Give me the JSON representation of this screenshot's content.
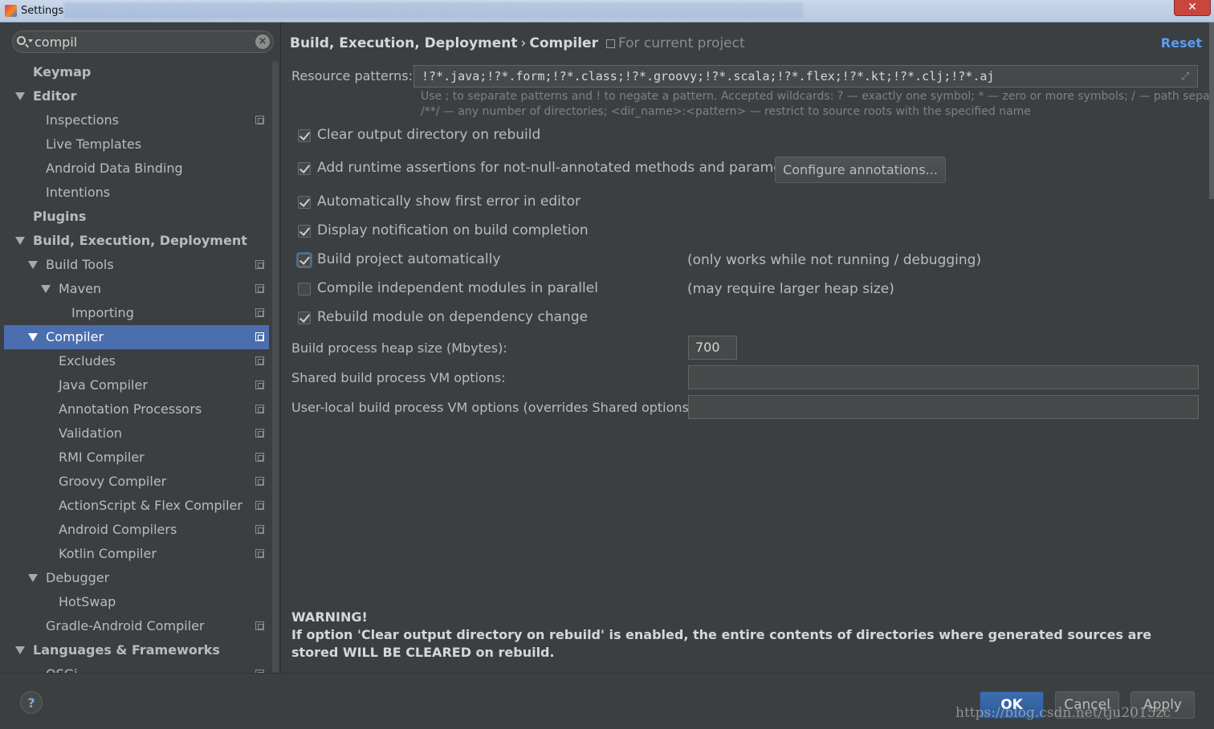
{
  "window": {
    "title": "Settings",
    "close_label": "✕"
  },
  "search": {
    "value": "compil"
  },
  "tree": [
    {
      "label": "Keymap",
      "bold": true,
      "indent": 0,
      "arrow": false,
      "proj": false
    },
    {
      "label": "Editor",
      "bold": true,
      "indent": 0,
      "arrow": true,
      "proj": false
    },
    {
      "label": "Inspections",
      "bold": false,
      "indent": 1,
      "arrow": false,
      "proj": true
    },
    {
      "label": "Live Templates",
      "bold": false,
      "indent": 1,
      "arrow": false,
      "proj": false
    },
    {
      "label": "Android Data Binding",
      "bold": false,
      "indent": 1,
      "arrow": false,
      "proj": false
    },
    {
      "label": "Intentions",
      "bold": false,
      "indent": 1,
      "arrow": false,
      "proj": false
    },
    {
      "label": "Plugins",
      "bold": true,
      "indent": 0,
      "arrow": false,
      "proj": false
    },
    {
      "label": "Build, Execution, Deployment",
      "bold": true,
      "indent": 0,
      "arrow": true,
      "proj": false
    },
    {
      "label": "Build Tools",
      "bold": false,
      "indent": 1,
      "arrow": true,
      "proj": true
    },
    {
      "label": "Maven",
      "bold": false,
      "indent": 2,
      "arrow": true,
      "proj": true
    },
    {
      "label": "Importing",
      "bold": false,
      "indent": 3,
      "arrow": false,
      "proj": true
    },
    {
      "label": "Compiler",
      "bold": false,
      "indent": 1,
      "arrow": true,
      "proj": true,
      "selected": true
    },
    {
      "label": "Excludes",
      "bold": false,
      "indent": 2,
      "arrow": false,
      "proj": true
    },
    {
      "label": "Java Compiler",
      "bold": false,
      "indent": 2,
      "arrow": false,
      "proj": true
    },
    {
      "label": "Annotation Processors",
      "bold": false,
      "indent": 2,
      "arrow": false,
      "proj": true
    },
    {
      "label": "Validation",
      "bold": false,
      "indent": 2,
      "arrow": false,
      "proj": true
    },
    {
      "label": "RMI Compiler",
      "bold": false,
      "indent": 2,
      "arrow": false,
      "proj": true
    },
    {
      "label": "Groovy Compiler",
      "bold": false,
      "indent": 2,
      "arrow": false,
      "proj": true
    },
    {
      "label": "ActionScript & Flex Compiler",
      "bold": false,
      "indent": 2,
      "arrow": false,
      "proj": true
    },
    {
      "label": "Android Compilers",
      "bold": false,
      "indent": 2,
      "arrow": false,
      "proj": true
    },
    {
      "label": "Kotlin Compiler",
      "bold": false,
      "indent": 2,
      "arrow": false,
      "proj": true
    },
    {
      "label": "Debugger",
      "bold": false,
      "indent": 1,
      "arrow": true,
      "proj": false
    },
    {
      "label": "HotSwap",
      "bold": false,
      "indent": 2,
      "arrow": false,
      "proj": false
    },
    {
      "label": "Gradle-Android Compiler",
      "bold": false,
      "indent": 1,
      "arrow": false,
      "proj": true
    },
    {
      "label": "Languages & Frameworks",
      "bold": true,
      "indent": 0,
      "arrow": true,
      "proj": false
    },
    {
      "label": "OSGi",
      "bold": false,
      "indent": 1,
      "arrow": false,
      "proj": true
    }
  ],
  "header": {
    "crumb1": "Build, Execution, Deployment",
    "sep": "›",
    "crumb2": "Compiler",
    "scope": "For current project",
    "reset": "Reset"
  },
  "resource": {
    "label": "Resource patterns:",
    "value": "!?*.java;!?*.form;!?*.class;!?*.groovy;!?*.scala;!?*.flex;!?*.kt;!?*.clj;!?*.aj",
    "hint1": "Use ; to separate patterns and ! to negate a pattern. Accepted wildcards: ? — exactly one symbol; * — zero or more symbols; / — path separator;",
    "hint2": "/**/ — any number of directories; <dir_name>:<pattern> — restrict to source roots with the specified name"
  },
  "options": {
    "clear_output": {
      "label": "Clear output directory on rebuild",
      "checked": true
    },
    "runtime_assertions": {
      "label": "Add runtime assertions for not-null-annotated methods and parameters",
      "checked": true
    },
    "configure_annotations": "Configure annotations...",
    "show_first_error": {
      "label": "Automatically show first error in editor",
      "checked": true
    },
    "notify_build": {
      "label": "Display notification on build completion",
      "checked": true
    },
    "build_auto": {
      "label": "Build project automatically",
      "checked": true,
      "note": "(only works while not running / debugging)"
    },
    "parallel": {
      "label": "Compile independent modules in parallel",
      "checked": false,
      "note": "(may require larger heap size)"
    },
    "rebuild_dep": {
      "label": "Rebuild module on dependency change",
      "checked": true
    }
  },
  "heap": {
    "label": "Build process heap size (Mbytes):",
    "value": "700"
  },
  "shared_vm": {
    "label": "Shared build process VM options:",
    "value": ""
  },
  "user_vm": {
    "label": "User-local build process VM options (overrides Shared options):",
    "value": ""
  },
  "warning": {
    "title": "WARNING!",
    "text": "If option 'Clear output directory on rebuild' is enabled, the entire contents of directories where generated sources are stored WILL BE CLEARED on rebuild."
  },
  "footer": {
    "help": "?",
    "ok": "OK",
    "cancel": "Cancel",
    "apply": "Apply"
  },
  "watermark": "https://blog.csdn.net/tju2015zc"
}
